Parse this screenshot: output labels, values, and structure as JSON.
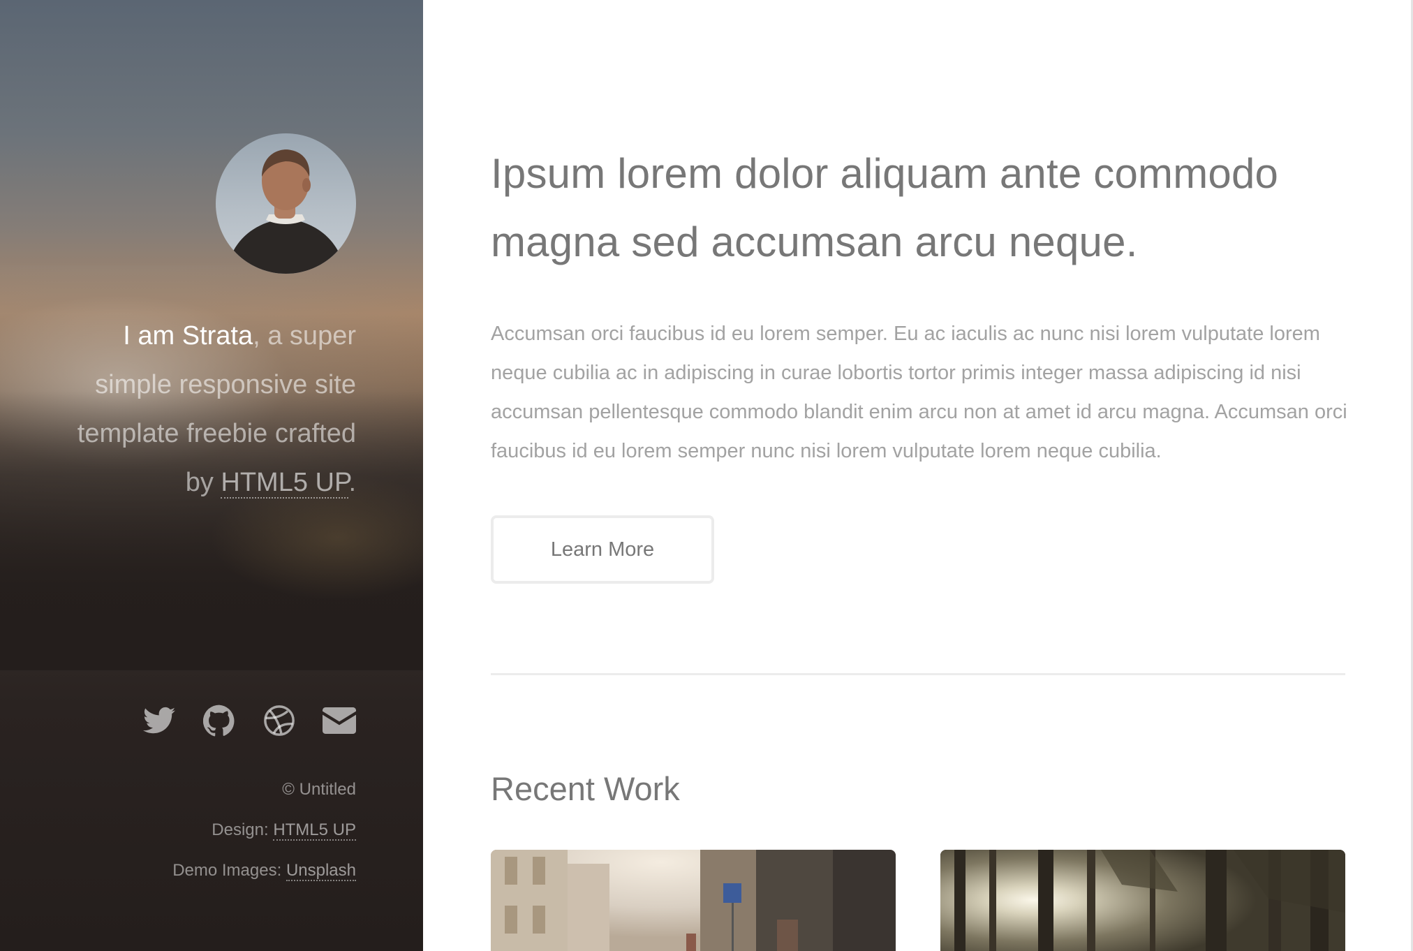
{
  "sidebar": {
    "intro": {
      "strong": "I am Strata",
      "rest_before_link": ", a super simple responsive site template freebie crafted by ",
      "link": "HTML5 UP",
      "period": "."
    },
    "social": [
      {
        "icon": "twitter-icon",
        "label": "Twitter"
      },
      {
        "icon": "github-icon",
        "label": "GitHub"
      },
      {
        "icon": "dribbble-icon",
        "label": "Dribbble"
      },
      {
        "icon": "email-icon",
        "label": "Email"
      }
    ],
    "footer": {
      "copyright": "© Untitled",
      "design_label": "Design: ",
      "design_link": "HTML5 UP",
      "images_label": "Demo Images: ",
      "images_link": "Unsplash"
    }
  },
  "main": {
    "headline": "Ipsum lorem dolor aliquam ante commodo magna sed accumsan arcu neque.",
    "body": "Accumsan orci faucibus id eu lorem semper. Eu ac iaculis ac nunc nisi lorem vulputate lorem neque cubilia ac in adipiscing in curae lobortis tortor primis integer massa adipiscing id nisi accumsan pellentesque commodo blandit enim arcu non at amet id arcu magna. Accumsan orci faucibus id eu lorem semper nunc nisi lorem vulputate lorem neque cubilia.",
    "button_label": "Learn More",
    "recent_work_title": "Recent Work"
  },
  "colors": {
    "heading": "#777777",
    "body_text": "#a2a2a2",
    "sidebar_dark": "#241e1c",
    "border": "#ececec"
  }
}
